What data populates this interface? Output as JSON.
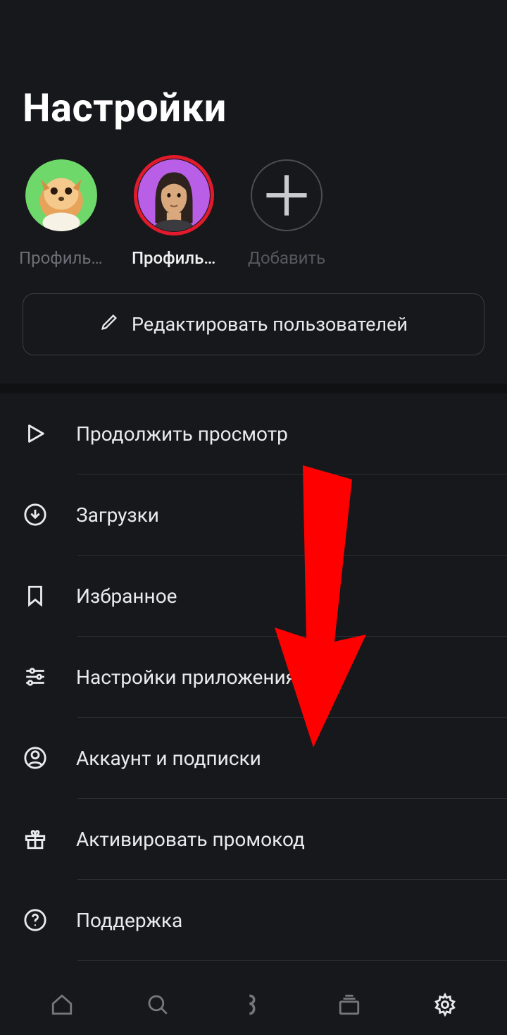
{
  "header": {
    "title": "Настройки"
  },
  "profiles": {
    "items": [
      {
        "label": "Профиль …",
        "active": false
      },
      {
        "label": "Профиль …",
        "active": true
      }
    ],
    "add_label": "Добавить"
  },
  "edit_users_label": "Редактировать пользователей",
  "menu": {
    "items": [
      {
        "icon": "play-icon",
        "label": "Продолжить просмотр"
      },
      {
        "icon": "download-icon",
        "label": "Загрузки"
      },
      {
        "icon": "bookmark-icon",
        "label": "Избранное"
      },
      {
        "icon": "sliders-icon",
        "label": "Настройки приложения"
      },
      {
        "icon": "account-icon",
        "label": "Аккаунт и подписки"
      },
      {
        "icon": "gift-icon",
        "label": "Активировать промокод"
      },
      {
        "icon": "help-icon",
        "label": "Поддержка"
      }
    ]
  },
  "annotation": {
    "arrow_target": "Аккаунт и подписки",
    "arrow_color": "#ff0000"
  },
  "bottom_nav": {
    "items": [
      {
        "icon": "home-icon"
      },
      {
        "icon": "search-icon"
      },
      {
        "icon": "logo-icon"
      },
      {
        "icon": "library-icon"
      },
      {
        "icon": "settings-icon",
        "active": true
      }
    ]
  }
}
